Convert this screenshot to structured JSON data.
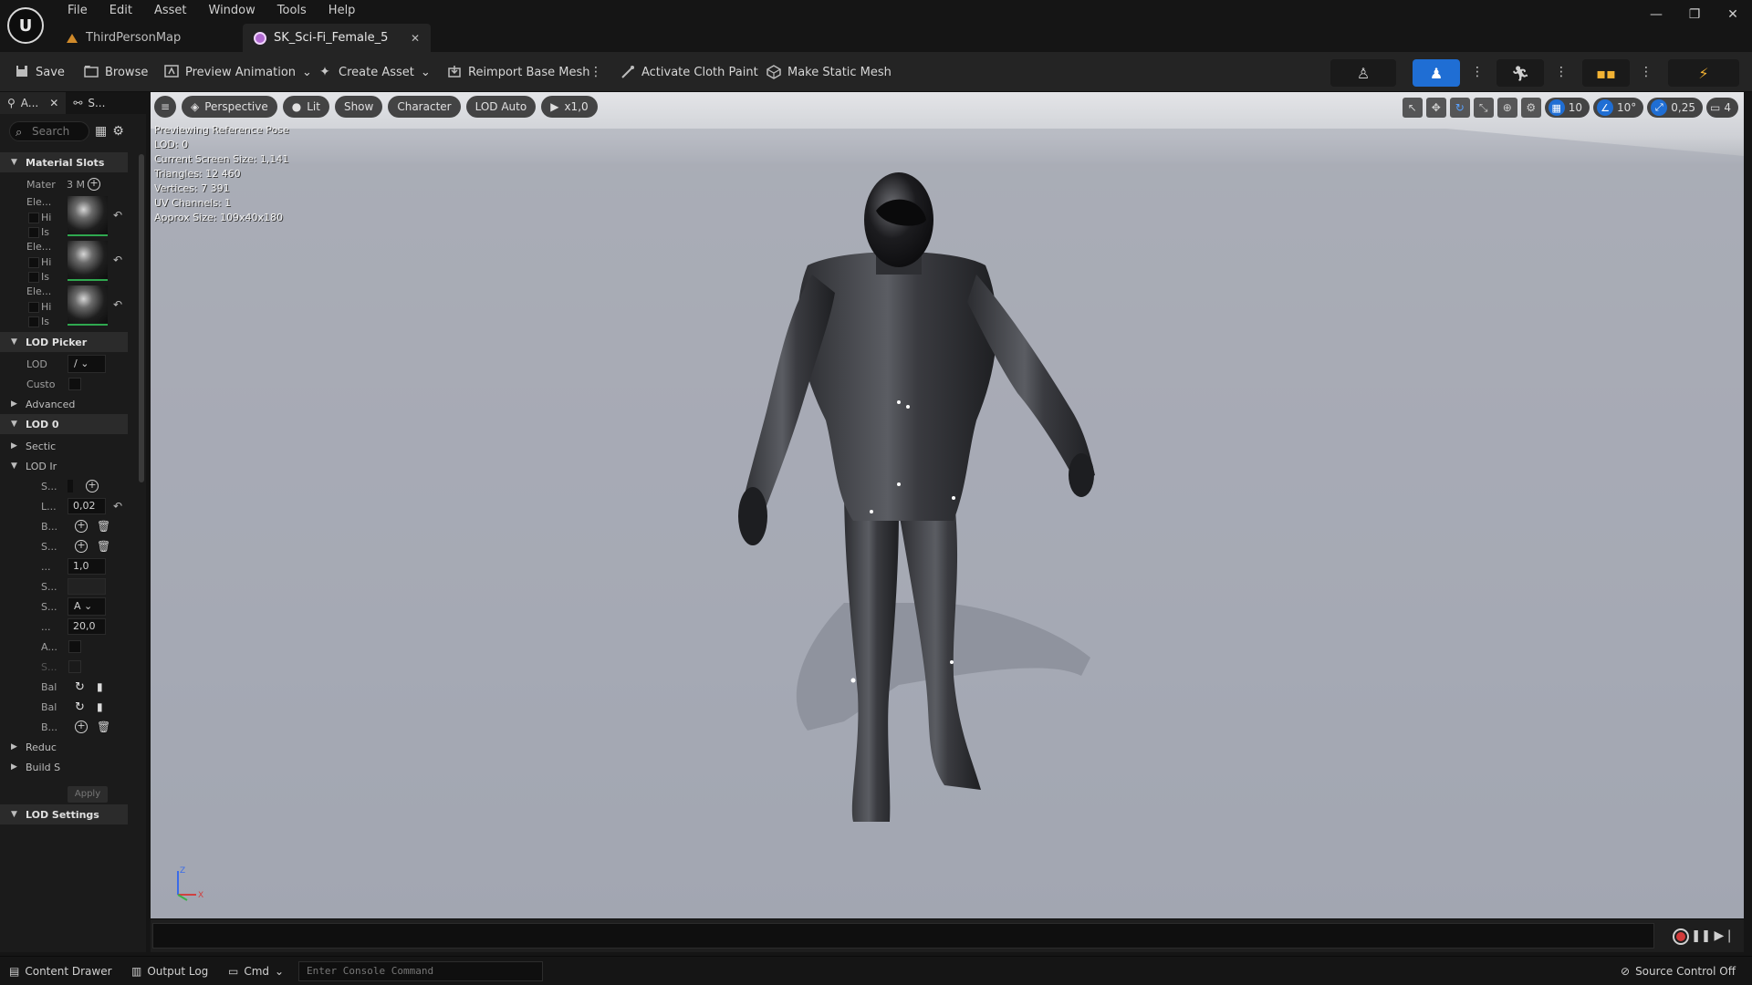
{
  "menu": [
    "File",
    "Edit",
    "Asset",
    "Window",
    "Tools",
    "Help"
  ],
  "tabs": [
    {
      "label": "ThirdPersonMap",
      "active": false
    },
    {
      "label": "SK_Sci-Fi_Female_5",
      "active": true
    }
  ],
  "toolbar": {
    "save": "Save",
    "browse": "Browse",
    "preview_animation": "Preview Animation",
    "create_asset": "Create Asset",
    "reimport": "Reimport Base Mesh",
    "cloth_paint": "Activate Cloth Paint",
    "static_mesh": "Make Static Mesh"
  },
  "left_panel": {
    "tabs": [
      "A...",
      "S..."
    ],
    "search_placeholder": "Search",
    "material_slots": {
      "title": "Material Slots",
      "mater_label": "Mater",
      "mater_value": "3 M",
      "elements": [
        {
          "label": "Ele...",
          "hi": "Hi",
          "is": "Is"
        },
        {
          "label": "Ele...",
          "hi": "Hi",
          "is": "Is"
        },
        {
          "label": "Ele...",
          "hi": "Hi",
          "is": "Is"
        }
      ]
    },
    "lod_picker": {
      "title": "LOD Picker",
      "lod_label": "LOD",
      "lod_value": "/",
      "custom_label": "Custo"
    },
    "advanced": "Advanced",
    "lod0": {
      "title": "LOD 0",
      "section": "Sectic",
      "lod_info": "LOD Ir",
      "rows": [
        {
          "label": "S...",
          "kind": "plus"
        },
        {
          "label": "L...",
          "kind": "field",
          "value": "0,02"
        },
        {
          "label": "B...",
          "kind": "plus-trash"
        },
        {
          "label": "S...",
          "kind": "plus-trash"
        },
        {
          "label": "...",
          "kind": "field",
          "value": "1,0"
        },
        {
          "label": "S...",
          "kind": "empty"
        },
        {
          "label": "S...",
          "kind": "dropdown",
          "value": "A"
        },
        {
          "label": "...",
          "kind": "field",
          "value": "20,0"
        },
        {
          "label": "A...",
          "kind": "check"
        },
        {
          "label": "S...",
          "kind": "check"
        },
        {
          "label": "Bal",
          "kind": "reset"
        },
        {
          "label": "Bal",
          "kind": "reset"
        },
        {
          "label": "B...",
          "kind": "plus-trash"
        }
      ],
      "reduce": "Reduc",
      "build": "Build S",
      "apply": "Apply"
    },
    "lod_settings": "LOD Settings"
  },
  "viewport": {
    "perspective": "Perspective",
    "lit": "Lit",
    "show": "Show",
    "character": "Character",
    "lod": "LOD Auto",
    "speed": "x1,0",
    "grid": "10",
    "angle": "10°",
    "scale": "0,25",
    "camera": "4",
    "stats": [
      "Previewing Reference Pose",
      "LOD: 0",
      "Current Screen Size: 1,141",
      "Triangles: 12 460",
      "Vertices: 7 391",
      "UV Channels: 1",
      "Approx Size: 109x40x180"
    ]
  },
  "statusbar": {
    "content_drawer": "Content Drawer",
    "output_log": "Output Log",
    "cmd": "Cmd",
    "console_placeholder": "Enter Console Command",
    "source_control": "Source Control Off"
  }
}
